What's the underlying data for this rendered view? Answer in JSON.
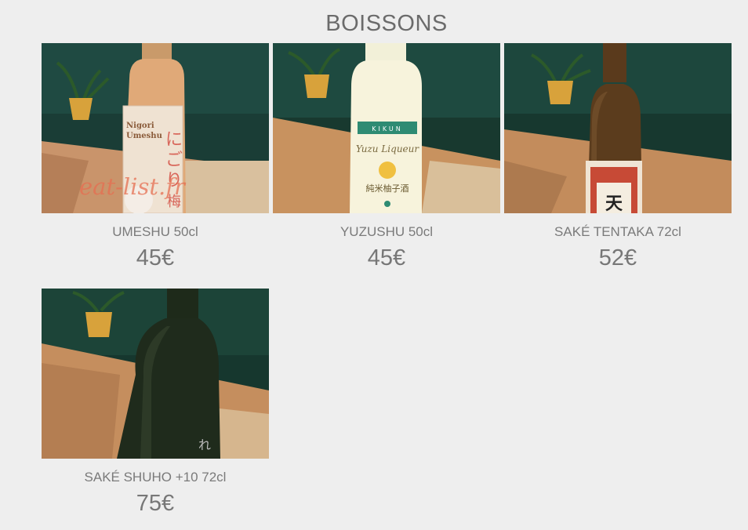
{
  "section": {
    "title": "BOISSONS"
  },
  "items": [
    {
      "name": "UMESHU 50cl",
      "price": "45€",
      "label_lines": [
        "Nigori",
        "Umeshu"
      ],
      "watermark": "eat-list.fr"
    },
    {
      "name": "YUZUSHU 50cl",
      "price": "45€",
      "label_lines": [
        "KIKUN",
        "Yuzu Liqueur",
        "純米柚子酒"
      ]
    },
    {
      "name": "SAKÉ TENTAKA 72cl",
      "price": "52€"
    },
    {
      "name": "SAKÉ SHUHO +10 72cl",
      "price": "75€"
    }
  ],
  "colors": {
    "background": "#eeeeee",
    "wall": "#123a33",
    "table": "#c9946b"
  }
}
